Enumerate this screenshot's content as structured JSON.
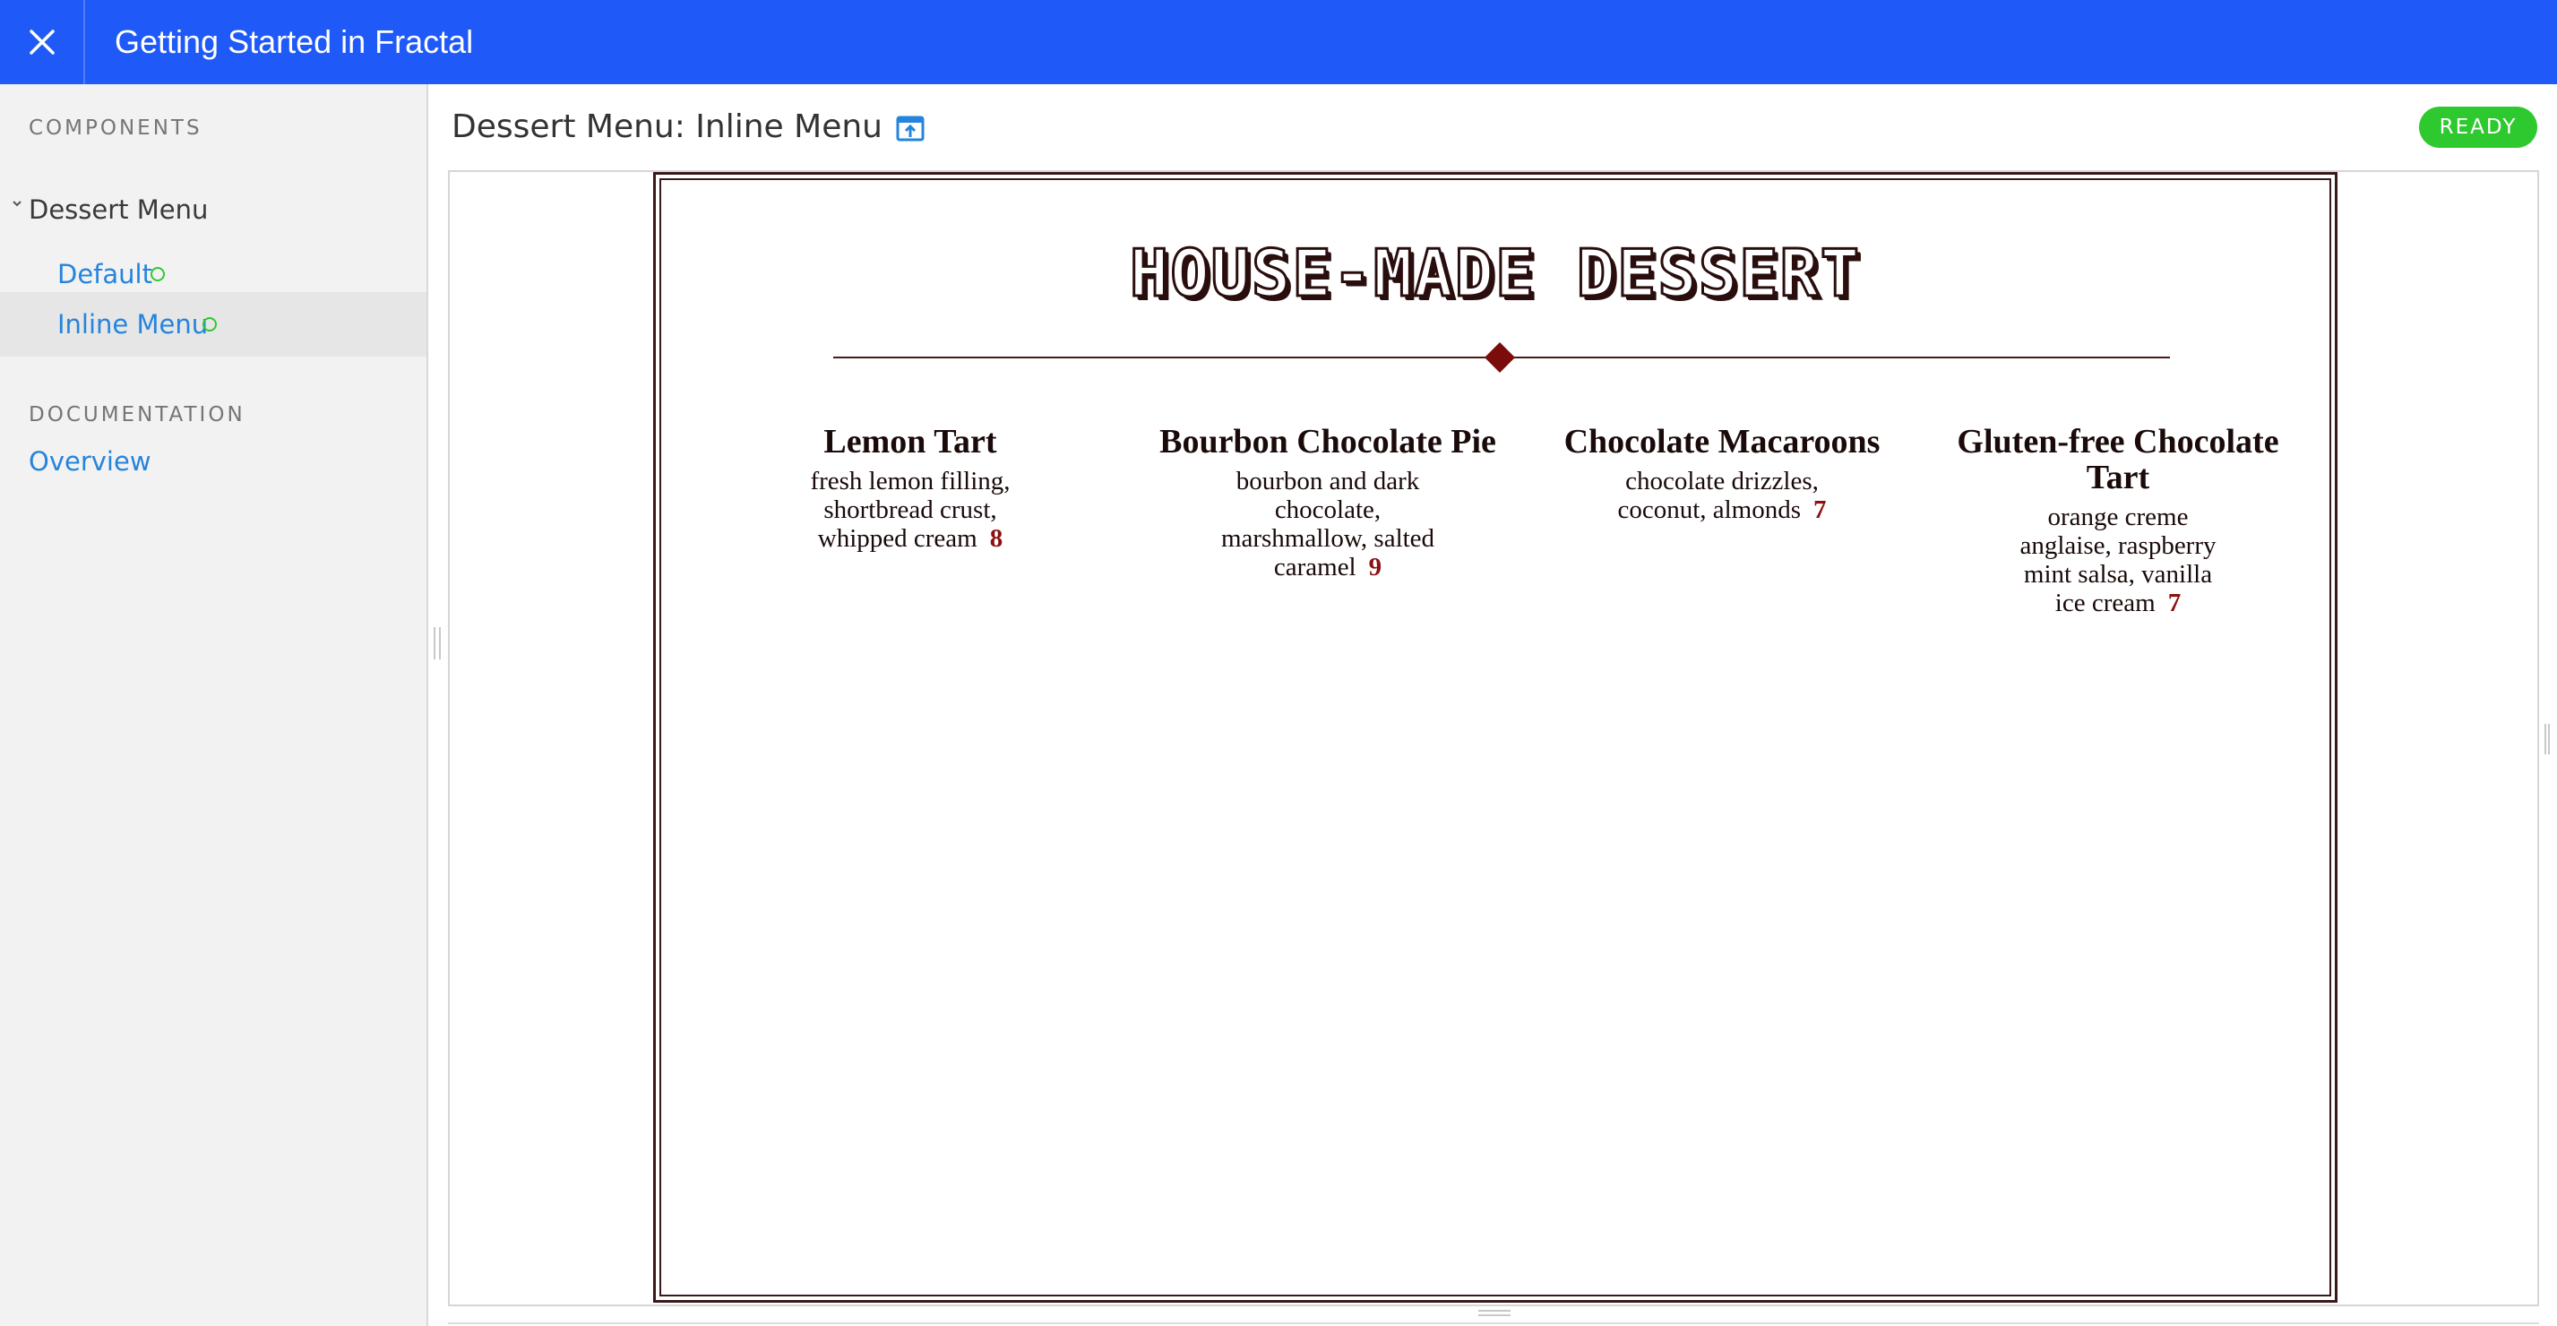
{
  "header": {
    "title": "Getting Started in Fractal",
    "close_icon": "close-icon"
  },
  "sidebar": {
    "components_label": "COMPONENTS",
    "collection": {
      "label": "Dessert Menu",
      "expanded": true,
      "items": [
        {
          "label": "Default",
          "status": "ready"
        },
        {
          "label": "Inline Menu",
          "status": "ready",
          "active": true
        }
      ]
    },
    "documentation_label": "DOCUMENTATION",
    "docs": [
      {
        "label": "Overview"
      }
    ]
  },
  "main": {
    "page_title": "Dessert Menu: Inline Menu",
    "open_in_new_icon": "open-external-icon",
    "status_badge": "READY"
  },
  "menu": {
    "heading": "HOUSE-MADE DESSERT",
    "items": [
      {
        "name": "Lemon Tart",
        "desc_lines": [
          "fresh lemon filling,",
          "shortbread crust,",
          "whipped cream"
        ],
        "price": "8"
      },
      {
        "name": "Bourbon Chocolate Pie",
        "desc_lines": [
          "bourbon and dark",
          "chocolate,",
          "marshmallow, salted",
          "caramel"
        ],
        "price": "9"
      },
      {
        "name": "Chocolate Macaroons",
        "desc_lines": [
          "chocolate drizzles,",
          "coconut, almonds"
        ],
        "price": "7"
      },
      {
        "name_lines": [
          "Gluten-free Chocolate",
          "Tart"
        ],
        "desc_lines": [
          "orange creme",
          "anglaise, raspberry",
          "mint salsa, vanilla",
          "ice cream"
        ],
        "price": "7"
      }
    ]
  },
  "colors": {
    "header_bg": "#1f5af8",
    "link": "#2584dd",
    "status_green": "#2ec92e",
    "menu_brown": "#2a0e0e",
    "price_red": "#8b1010"
  }
}
